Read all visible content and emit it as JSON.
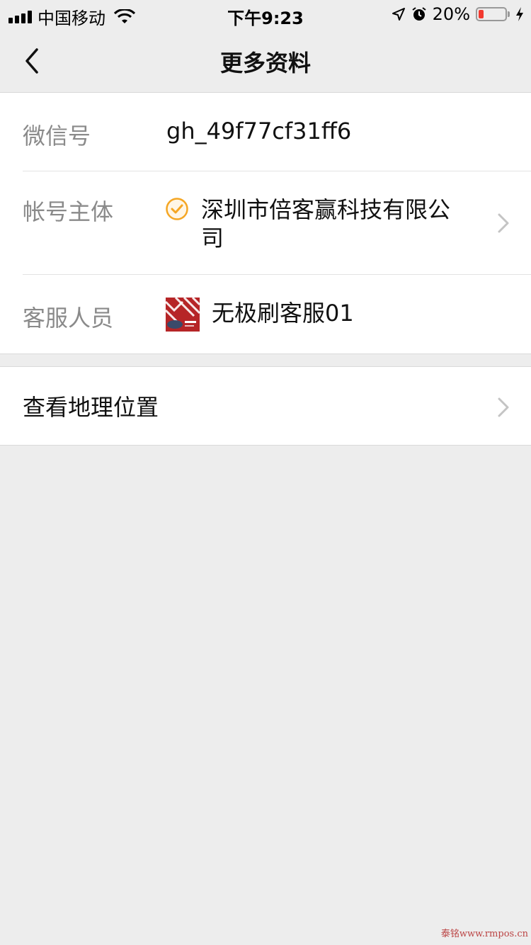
{
  "status_bar": {
    "carrier": "中国移动",
    "time": "下午9:23",
    "battery_percent": "20%",
    "battery_level": 0.2,
    "icons": [
      "signal-icon",
      "wifi-icon",
      "location-icon",
      "alarm-icon",
      "battery-icon",
      "charging-icon"
    ]
  },
  "nav": {
    "title": "更多资料",
    "back_icon": "chevron-left-icon"
  },
  "profile": {
    "wechat_id": {
      "label": "微信号",
      "value": "gh_49f77cf31ff6"
    },
    "entity": {
      "label": "帐号主体",
      "value": "深圳市倍客赢科技有限公司",
      "icon": "verified-check-icon"
    },
    "customer_service": {
      "label": "客服人员",
      "value": "无极刷客服01",
      "avatar_color": "#b62527"
    }
  },
  "location": {
    "label": "查看地理位置"
  },
  "colors": {
    "background": "#ededed",
    "verified": "#f5a623",
    "battery_low": "#f2392f"
  },
  "watermark": "泰铭www.rmpos.cn"
}
